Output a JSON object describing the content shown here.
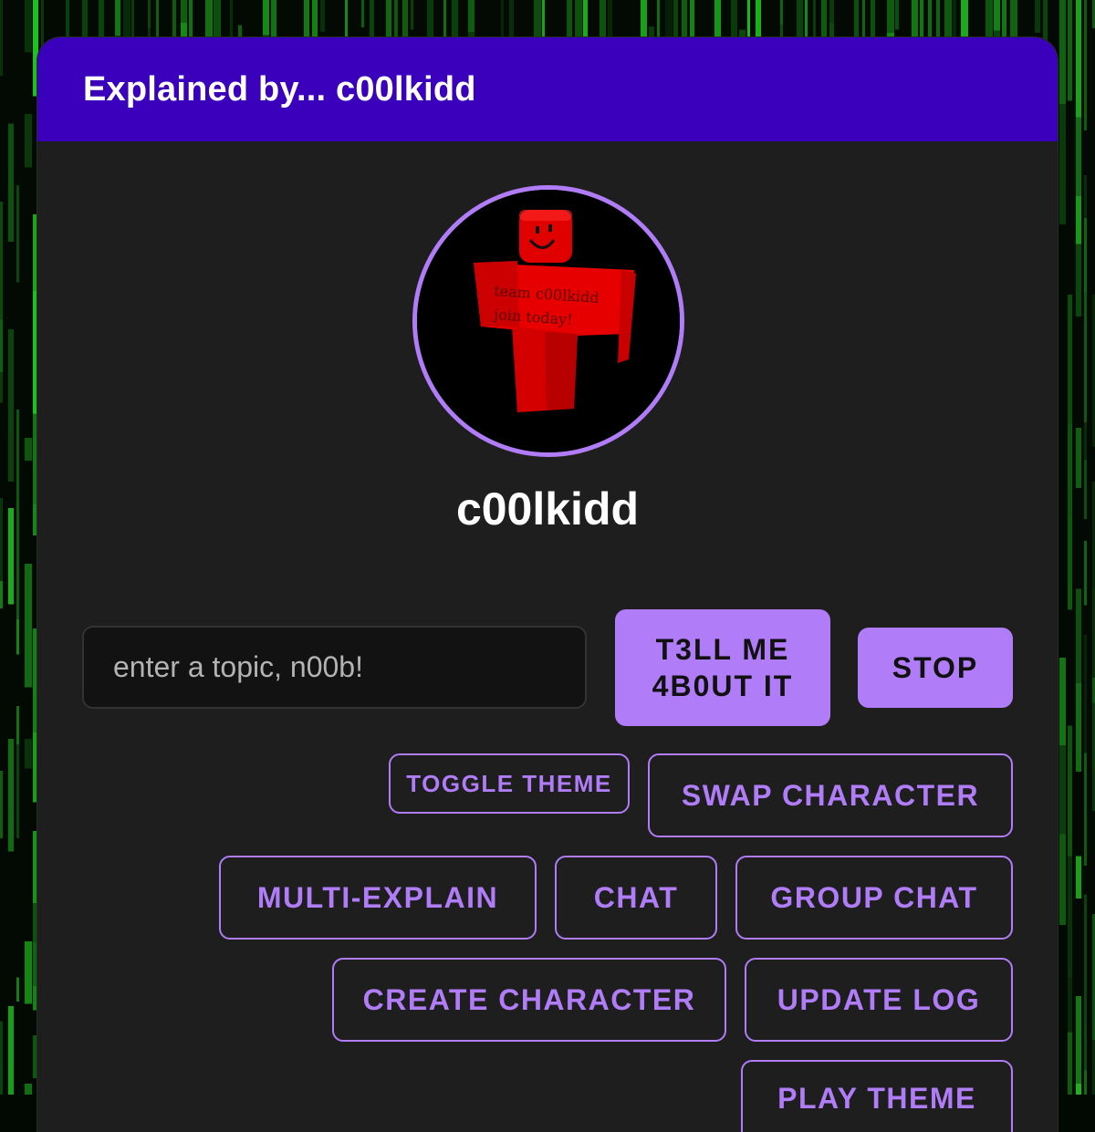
{
  "header": {
    "title": "Explained by... c00lkidd"
  },
  "character": {
    "name": "c00lkidd",
    "avatar_shirt_text": [
      "team c00lkidd",
      "join today!"
    ]
  },
  "topic": {
    "placeholder": "enter a topic, n00b!",
    "value": ""
  },
  "actions": {
    "tell_label": "T3LL ME 4B0UT IT",
    "stop_label": "STOP"
  },
  "menu": {
    "toggle_theme": "TOGGLE THEME",
    "swap_character": "SWAP CHARACTER",
    "multi_explain": "MULTI-EXPLAIN",
    "chat": "CHAT",
    "group_chat": "GROUP CHAT",
    "create_character": "CREATE CHARACTER",
    "update_log": "UPDATE LOG",
    "play_theme": "PLAY THEME"
  },
  "colors": {
    "accent": "#b07cf7",
    "header": "#3a00bb",
    "panel": "#1e1e1e",
    "matrix_green": "#1fd11f",
    "avatar_red": "#e00000"
  }
}
